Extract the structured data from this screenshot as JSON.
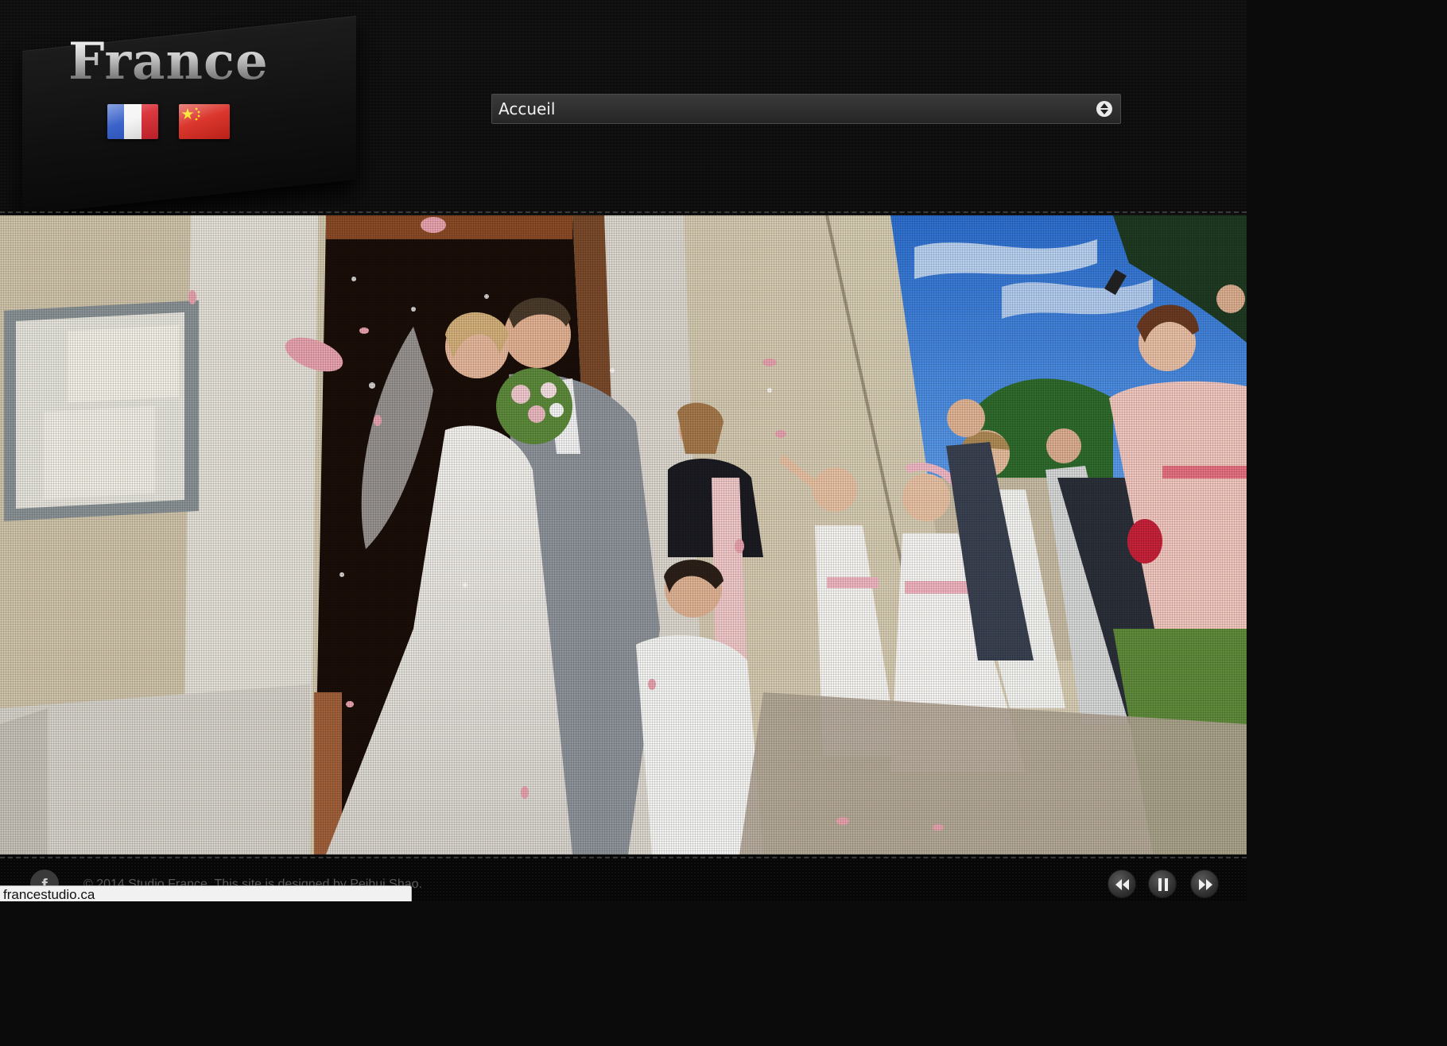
{
  "header": {
    "logo_text": "France",
    "languages": [
      {
        "code": "fr"
      },
      {
        "code": "cn"
      }
    ],
    "nav_select": {
      "selected": "Accueil"
    }
  },
  "photo": {
    "subject": "wedding-couple-kissing-leaving-church"
  },
  "footer": {
    "social": "f",
    "copyright": "© 2014 Studio France. This site is designed by Peihui Shao.",
    "controls": [
      "previous",
      "pause",
      "next"
    ]
  },
  "status_bar": {
    "url": "francestudio.ca"
  },
  "colors": {
    "background": "#0b0b0b",
    "select_bg": "#2f2f2f",
    "text_light": "#f2f2f2",
    "footer_text": "#5a5a5a"
  }
}
